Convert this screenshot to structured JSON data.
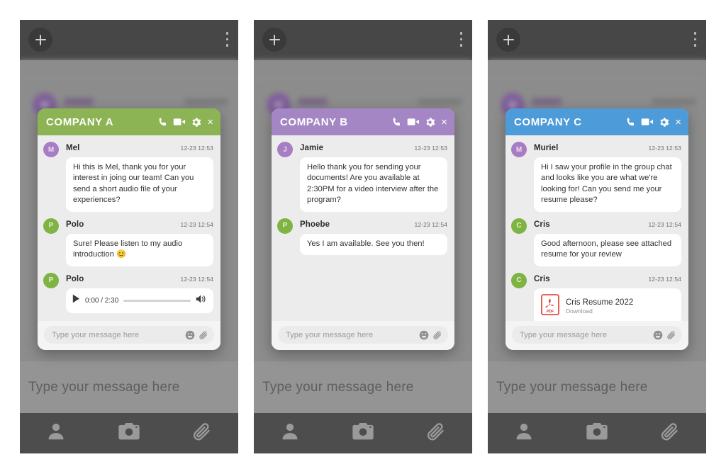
{
  "app": {
    "plus_label": "+",
    "menu_label": "more-options",
    "outer_placeholder": "Type your message here",
    "nav": [
      {
        "name": "contacts",
        "icon": "person-icon"
      },
      {
        "name": "camera",
        "icon": "camera-icon"
      },
      {
        "name": "attachment",
        "icon": "paperclip-icon"
      }
    ]
  },
  "colors": {
    "company_a": "#8cb354",
    "company_b": "#a586c4",
    "company_c": "#4d9bd8",
    "avatar_purple": "#a87dc4",
    "avatar_green": "#7fb344",
    "appbar": "#474747",
    "panel_bg": "#8c8c8c",
    "pdf_red": "#e2342a"
  },
  "header_icons": [
    {
      "name": "phone-icon",
      "label": "call"
    },
    {
      "name": "video-icon",
      "label": "video call"
    },
    {
      "name": "gear-icon",
      "label": "settings"
    },
    {
      "name": "close-icon",
      "label": "x"
    }
  ],
  "composer": {
    "placeholder": "Type your message here",
    "emoji_icon": "emoji-icon",
    "attach_icon": "paperclip-icon"
  },
  "panels": [
    {
      "id": "company-a",
      "title": "COMPANY A",
      "accent": "#8cb354",
      "messages": [
        {
          "type": "text",
          "sender": "Mel",
          "initial": "M",
          "avatar_color": "purple",
          "time": "12-23 12:53",
          "text": "Hi this is Mel, thank you for your interest in joing our team! Can you send a short audio file of your experiences?"
        },
        {
          "type": "text",
          "sender": "Polo",
          "initial": "P",
          "avatar_color": "green",
          "time": "12-23 12:54",
          "text": "Sure! Please listen to my audio introduction 😊"
        },
        {
          "type": "audio",
          "sender": "Polo",
          "initial": "P",
          "avatar_color": "green",
          "time": "12-23 12:54",
          "position": "0:00",
          "duration": "2:30",
          "time_display": "0:00 / 2:30"
        }
      ]
    },
    {
      "id": "company-b",
      "title": "COMPANY B",
      "accent": "#a586c4",
      "messages": [
        {
          "type": "text",
          "sender": "Jamie",
          "initial": "J",
          "avatar_color": "purple",
          "time": "12-23 12:53",
          "text": "Hello thank you for sending your documents! Are you available at 2:30PM for a video interview after the program?"
        },
        {
          "type": "text",
          "sender": "Phoebe",
          "initial": "P",
          "avatar_color": "green",
          "time": "12-23 12:54",
          "text": "Yes I am available. See you then!"
        }
      ]
    },
    {
      "id": "company-c",
      "title": "COMPANY C",
      "accent": "#4d9bd8",
      "messages": [
        {
          "type": "text",
          "sender": "Muriel",
          "initial": "M",
          "avatar_color": "purple",
          "time": "12-23 12:53",
          "text": "Hi I saw your profile in the group chat and looks like you are what we're looking for! Can you send me your resume please?"
        },
        {
          "type": "text",
          "sender": "Cris",
          "initial": "C",
          "avatar_color": "green",
          "time": "12-23 12:54",
          "text": "Good afternoon, please see attached resume for your review"
        },
        {
          "type": "file",
          "sender": "Cris",
          "initial": "C",
          "avatar_color": "green",
          "time": "12-23 12:54",
          "file_name": "Cris Resume 2022",
          "file_action": "Download",
          "file_type": "PDF"
        }
      ]
    }
  ]
}
